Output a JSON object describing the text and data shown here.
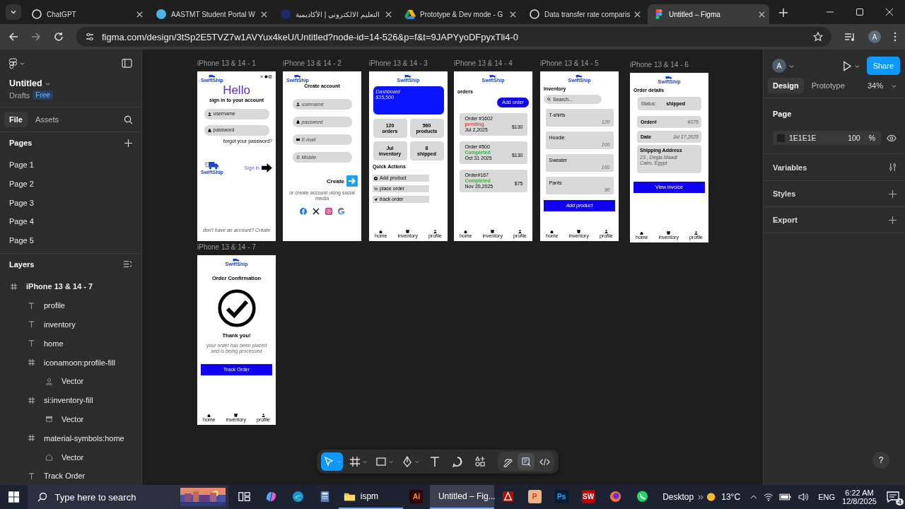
{
  "browser": {
    "tabs": [
      {
        "title": "ChatGPT",
        "kind": "chatgpt",
        "selected": false
      },
      {
        "title": "AASTMT Student Portal W",
        "kind": "portal",
        "selected": false
      },
      {
        "title": "التعليم الالكتروني | الأكاديمية",
        "kind": "academy",
        "selected": false
      },
      {
        "title": "Prototype & Dev mode - G",
        "kind": "drive",
        "selected": false
      },
      {
        "title": "Data transfer rate comparis",
        "kind": "chatgpt",
        "selected": false
      },
      {
        "title": "Untitled – Figma",
        "kind": "figma",
        "selected": true
      }
    ],
    "url": "figma.com/design/3tSp2E5TVZ7w1AVYux4keU/Untitled?node-id=14-526&p=f&t=9JAPYyoDFpyxTli4-0",
    "profile": "A"
  },
  "left_panel": {
    "file_name": "Untitled",
    "team": "Drafts",
    "plan": "Free",
    "tabs": [
      {
        "label": "File",
        "selected": true
      },
      {
        "label": "Assets",
        "selected": false
      }
    ],
    "pages_title": "Pages",
    "pages": [
      "Page 1",
      "Page 2",
      "Page 3",
      "Page 4",
      "Page 5"
    ],
    "layers_title": "Layers",
    "layers": [
      {
        "name": "iPhone 13 & 14 - 7",
        "kind": "frame",
        "children": [
          {
            "name": "profile",
            "kind": "text"
          },
          {
            "name": "inventory",
            "kind": "text"
          },
          {
            "name": "home",
            "kind": "text"
          },
          {
            "name": "iconamoon:profile-fill",
            "kind": "frame",
            "children": [
              {
                "name": "Vector",
                "kind": "person"
              }
            ]
          },
          {
            "name": "si:inventory-fill",
            "kind": "frame",
            "children": [
              {
                "name": "Vector",
                "kind": "box"
              }
            ]
          },
          {
            "name": "material-symbols:home",
            "kind": "frame",
            "children": [
              {
                "name": "Vector",
                "kind": "home"
              }
            ]
          },
          {
            "name": "Track Order",
            "kind": "text"
          }
        ]
      }
    ]
  },
  "frames": [
    {
      "label": "iPhone 13 & 14 - 1",
      "kind": "login",
      "logo": "SwiftShip",
      "heading": "Hello",
      "subtitle": "sign in to your account",
      "fields": [
        {
          "kind": "user",
          "placeholder": "username"
        },
        {
          "kind": "lock",
          "placeholder": "password"
        }
      ],
      "link": "forgot your password?",
      "brand": "SwiftShip",
      "action": "Sign in",
      "footer": "don't have an account? Create"
    },
    {
      "label": "iPhone 13 & 14 - 2",
      "kind": "signup",
      "logo": "SwiftShip",
      "title": "Create account",
      "fields": [
        {
          "kind": "user",
          "placeholder": "username"
        },
        {
          "kind": "lock",
          "placeholder": "password"
        },
        {
          "kind": "mail",
          "placeholder": "E-mail"
        },
        {
          "kind": "phone",
          "placeholder": "Mobile"
        }
      ],
      "action": "Create",
      "note": "or create account using social media"
    },
    {
      "label": "iPhone 13 & 14 - 3",
      "kind": "dashboard",
      "logo": "SwiftShip",
      "card_title": "Dashboard",
      "amount": "$15,500",
      "stats": [
        {
          "value": "120",
          "label": "orders"
        },
        {
          "value": "560",
          "label": "products"
        },
        {
          "value": "Jul",
          "label": "inventory"
        },
        {
          "value": "8",
          "label": "shipped"
        }
      ],
      "section": "Quick Actions",
      "actions": [
        {
          "kind": "plus",
          "label": "Add product"
        },
        {
          "kind": "cart",
          "label": "place order"
        },
        {
          "kind": "send",
          "label": "track order"
        }
      ],
      "nav": [
        "home",
        "inventory",
        "profile"
      ]
    },
    {
      "label": "iPhone 13 & 14 - 4",
      "kind": "orders",
      "logo": "SwiftShip",
      "title": "orders",
      "button": "Add order",
      "orders": [
        {
          "number": "Order #1602",
          "status": "pending",
          "color": "#e05050",
          "date": "Jul 2,2025",
          "amount": "$130"
        },
        {
          "number": "Order #500",
          "status": "Completed",
          "color": "#3cb043",
          "date": "Oct 31 2025",
          "amount": "$130"
        },
        {
          "number": "Order#167",
          "status": "Completed",
          "color": "#3cb043",
          "date": "Nov 20,2025",
          "amount": "$75"
        }
      ],
      "nav": [
        "home",
        "inventory",
        "profile"
      ]
    },
    {
      "label": "iPhone 13 & 14 - 5",
      "kind": "inventory",
      "logo": "SwiftShip",
      "title": "Inventory",
      "search": "Search...",
      "items": [
        {
          "name": "T-shirts",
          "count": "120"
        },
        {
          "name": "Hoodie",
          "count": "100"
        },
        {
          "name": "Sweater",
          "count": "160"
        },
        {
          "name": "Pants",
          "count": "90"
        }
      ],
      "button": "Add product",
      "nav": [
        "home",
        "inventory",
        "profile"
      ]
    },
    {
      "label": "iPhone 13 & 14 - 6",
      "kind": "order_details",
      "logo": "SwiftShip",
      "title": "Order details",
      "status_label": "Status:",
      "status": "shipped",
      "rows": [
        {
          "label": "Order#",
          "value": "#375"
        },
        {
          "label": "Date",
          "value": "Jul 17,2025"
        }
      ],
      "address_title": "Shipping Address",
      "address": "23 , Degla Maadi Cairo, Egypt",
      "button": "View invoice",
      "nav": [
        "home",
        "inventory",
        "profile"
      ]
    },
    {
      "label": "iPhone 13 & 14 - 7",
      "kind": "confirmation",
      "logo": "SwiftShip",
      "title": "Order Confirmation",
      "thanks": "Thank you!",
      "message": "your order has been placed and is being processed",
      "button": "Track Order",
      "nav": [
        "home",
        "inventory",
        "profile"
      ]
    }
  ],
  "toolbar": {
    "tools": [
      {
        "kind": "move",
        "selected": true
      },
      {
        "kind": "frame",
        "selected": false
      },
      {
        "kind": "rectangle",
        "selected": false
      },
      {
        "kind": "pen",
        "selected": false
      },
      {
        "kind": "text",
        "selected": false
      },
      {
        "kind": "comment",
        "selected": false
      },
      {
        "kind": "actions",
        "selected": false
      }
    ],
    "modes": [
      {
        "kind": "draw",
        "selected": false
      },
      {
        "kind": "design",
        "selected": true
      },
      {
        "kind": "dev",
        "selected": false
      }
    ],
    "help": "?"
  },
  "right_panel": {
    "avatar": "A",
    "share": "Share",
    "tabs": [
      {
        "label": "Design",
        "selected": true
      },
      {
        "label": "Prototype",
        "selected": false
      }
    ],
    "zoom": "34%",
    "page_title": "Page",
    "fill": "1E1E1E",
    "opacity": "100",
    "unit": "%",
    "sections": [
      {
        "title": "Variables",
        "kind": "variables"
      },
      {
        "title": "Styles",
        "kind": "add"
      },
      {
        "title": "Export",
        "kind": "add"
      }
    ]
  },
  "taskbar": {
    "search": "Type here to search",
    "apps": [
      {
        "kind": "task-view",
        "open": false,
        "selected": false
      },
      {
        "kind": "copilot",
        "open": false,
        "selected": false
      },
      {
        "kind": "edge",
        "open": false,
        "selected": false
      },
      {
        "kind": "calculator",
        "open": false,
        "selected": false
      },
      {
        "kind": "explorer",
        "label": "ispm",
        "open": true,
        "selected": false
      },
      {
        "kind": "illustrator",
        "glyph": "Ai",
        "open": false,
        "selected": false
      },
      {
        "kind": "chrome",
        "label": "Untitled – Fig...",
        "open": true,
        "selected": true
      },
      {
        "kind": "acrobat",
        "open": false,
        "selected": false
      },
      {
        "kind": "powerpoint",
        "glyph": "P",
        "open": false,
        "selected": false
      },
      {
        "kind": "photoshop",
        "glyph": "Ps",
        "open": false,
        "selected": false
      },
      {
        "kind": "solidworks",
        "glyph": "SW",
        "open": false,
        "selected": false
      },
      {
        "kind": "firefox",
        "open": false,
        "selected": false
      },
      {
        "kind": "whatsapp",
        "open": false,
        "selected": false
      }
    ],
    "desktop": "Desktop",
    "weather": "13°C",
    "language": "ENG",
    "time": "6:22 AM",
    "date": "12/8/2025",
    "notifications": "4"
  }
}
